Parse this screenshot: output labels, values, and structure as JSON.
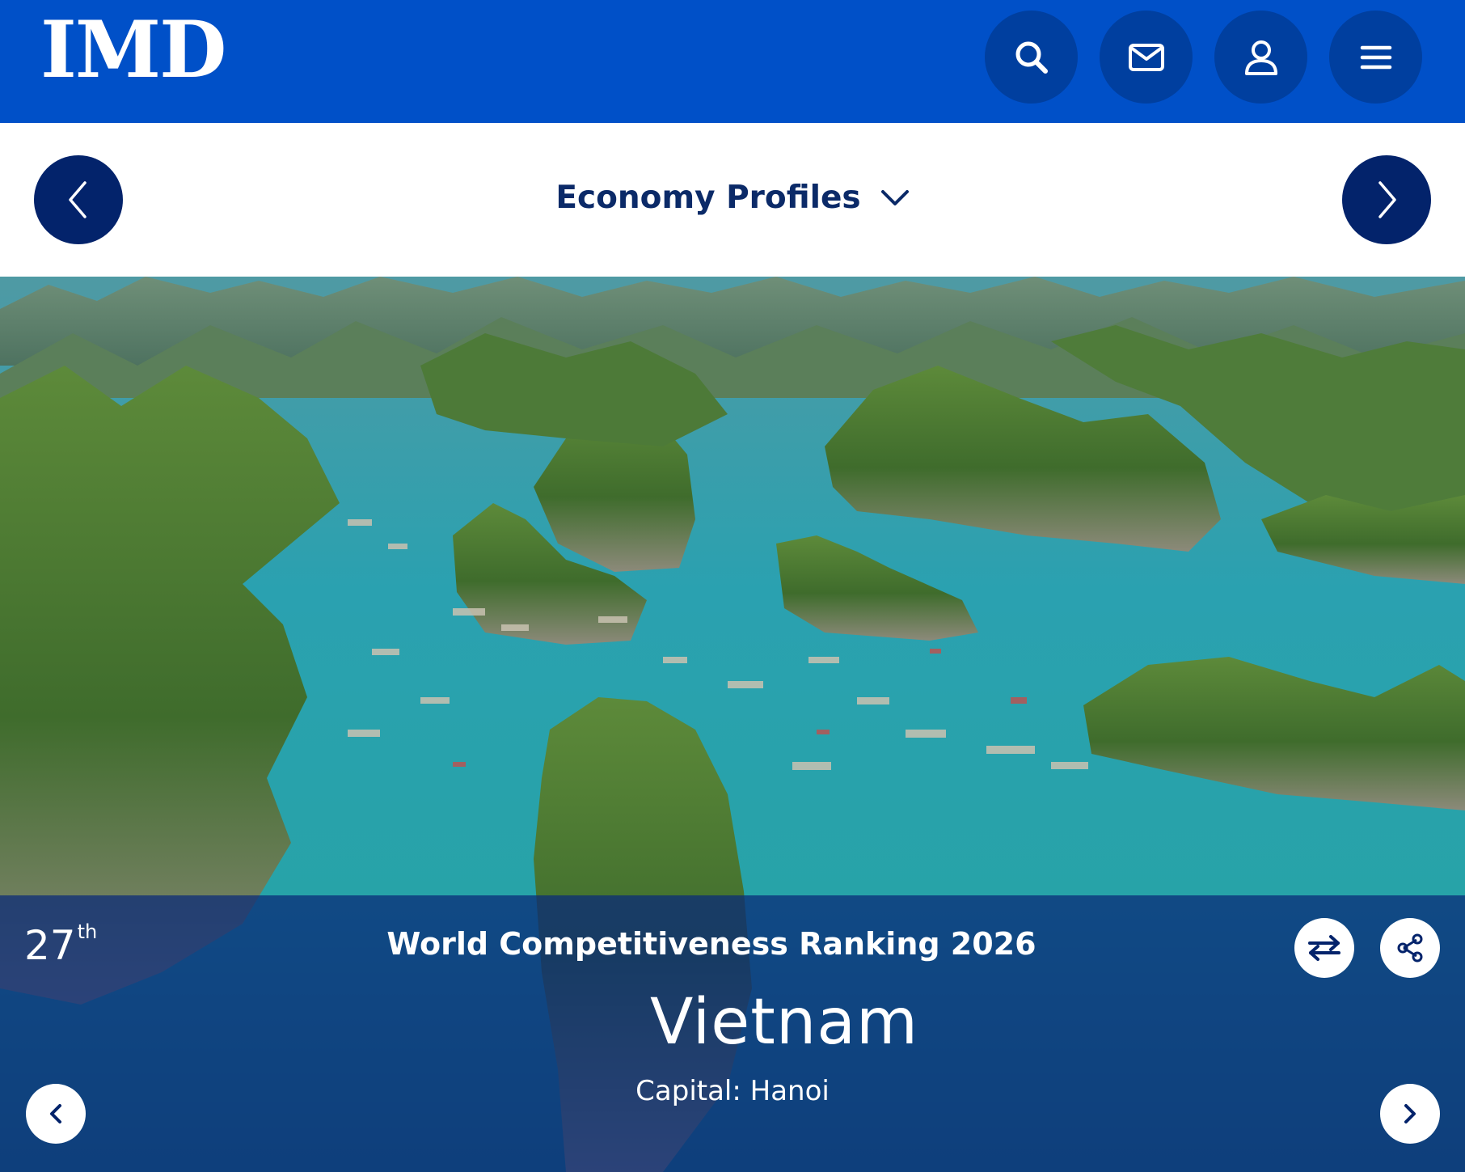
{
  "header": {
    "logo_text": "IMD",
    "brand_color": "#0050c8",
    "buttons": [
      {
        "name": "search",
        "icon": "search-icon"
      },
      {
        "name": "contact",
        "icon": "mail-icon"
      },
      {
        "name": "account",
        "icon": "user-icon"
      },
      {
        "name": "menu",
        "icon": "hamburger-icon"
      }
    ]
  },
  "subnav": {
    "title": "Economy Profiles",
    "accent_color": "#03236b",
    "prev_icon": "chevron-left-icon",
    "next_icon": "chevron-right-icon",
    "dropdown_icon": "chevron-down-icon"
  },
  "profile": {
    "rank_number": "27",
    "rank_suffix": "th",
    "ranking_title": "World Competitiveness Ranking 2026",
    "country": "Vietnam",
    "capital": "Capital: Hanoi",
    "hero_image": "ha-long-bay-landscape",
    "actions": [
      {
        "name": "compare",
        "icon": "swap-arrows-icon"
      },
      {
        "name": "share",
        "icon": "share-icon"
      }
    ],
    "prev_icon": "chevron-left-icon",
    "next_icon": "chevron-right-icon"
  }
}
